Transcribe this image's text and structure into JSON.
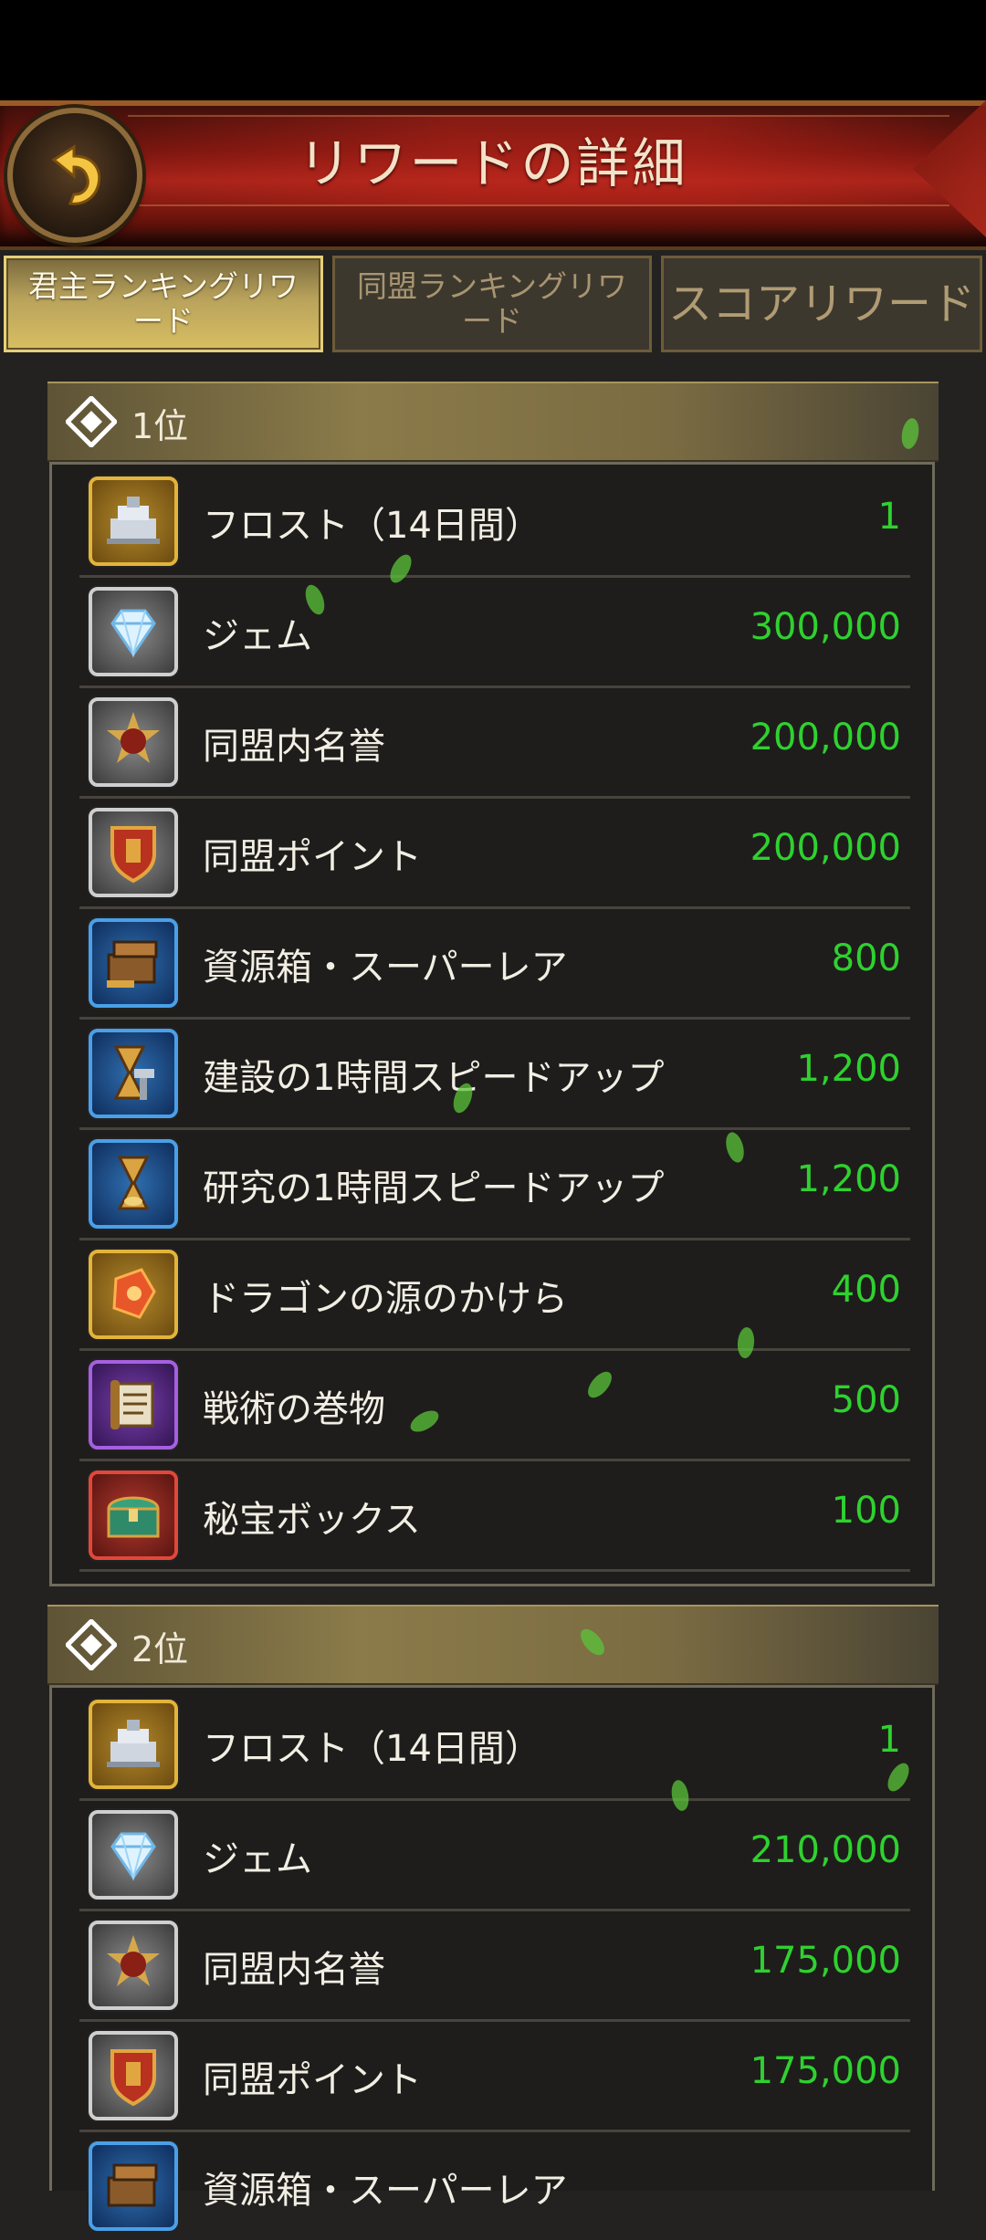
{
  "header": {
    "title": "リワードの詳細",
    "back_icon": "back-arrow-icon"
  },
  "tabs": [
    {
      "label": "君主ランキングリワード",
      "active": true
    },
    {
      "label": "同盟ランキングリワード",
      "active": false
    },
    {
      "label": "スコアリワード",
      "active": false
    }
  ],
  "ranks": [
    {
      "title": "1位",
      "items": [
        {
          "name": "フロスト（14日間）",
          "qty": "1",
          "icon": "frost-castle-icon"
        },
        {
          "name": "ジェム",
          "qty": "300,000",
          "icon": "gem-icon"
        },
        {
          "name": "同盟内名誉",
          "qty": "200,000",
          "icon": "alliance-honor-icon"
        },
        {
          "name": "同盟ポイント",
          "qty": "200,000",
          "icon": "alliance-points-icon"
        },
        {
          "name": "資源箱・スーパーレア",
          "qty": "800",
          "icon": "resource-box-icon"
        },
        {
          "name": "建設の1時間スピードアップ",
          "qty": "1,200",
          "icon": "build-speedup-icon"
        },
        {
          "name": "研究の1時間スピードアップ",
          "qty": "1,200",
          "icon": "research-speedup-icon"
        },
        {
          "name": "ドラゴンの源のかけら",
          "qty": "400",
          "icon": "dragon-shard-icon"
        },
        {
          "name": "戦術の巻物",
          "qty": "500",
          "icon": "tactics-scroll-icon"
        },
        {
          "name": "秘宝ボックス",
          "qty": "100",
          "icon": "treasure-chest-icon"
        }
      ]
    },
    {
      "title": "2位",
      "items": [
        {
          "name": "フロスト（14日間）",
          "qty": "1",
          "icon": "frost-castle-icon"
        },
        {
          "name": "ジェム",
          "qty": "210,000",
          "icon": "gem-icon"
        },
        {
          "name": "同盟内名誉",
          "qty": "175,000",
          "icon": "alliance-honor-icon"
        },
        {
          "name": "同盟ポイント",
          "qty": "175,000",
          "icon": "alliance-points-icon"
        },
        {
          "name": "資源箱・スーパーレア",
          "qty": "",
          "icon": "resource-box-icon"
        }
      ]
    }
  ],
  "colors": {
    "qty": "#2fd12f",
    "header": "#a8241a",
    "tab_active": "#d8be62"
  }
}
